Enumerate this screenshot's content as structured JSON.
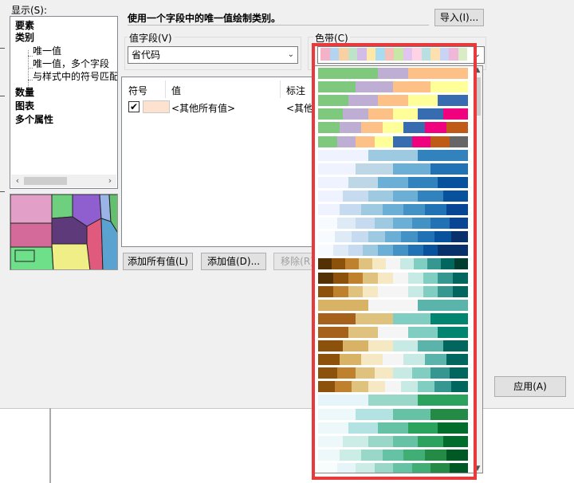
{
  "dialog": {
    "show_label": "显示(S):",
    "tree": [
      {
        "label": "要素",
        "bold": true,
        "indent": 0
      },
      {
        "label": "类别",
        "bold": true,
        "indent": 0
      },
      {
        "label": "唯一值",
        "bold": false,
        "indent": 1
      },
      {
        "label": "唯一值，多个字段",
        "bold": false,
        "indent": 1
      },
      {
        "label": "与样式中的符号匹配",
        "bold": false,
        "indent": 1
      },
      {
        "label": "数量",
        "bold": true,
        "indent": 0
      },
      {
        "label": "图表",
        "bold": true,
        "indent": 0
      },
      {
        "label": "多个属性",
        "bold": true,
        "indent": 0
      }
    ],
    "description": "使用一个字段中的唯一值绘制类别。",
    "import_button": "导入(I)...",
    "value_field": {
      "label": "值字段(V)",
      "value": "省代码"
    },
    "color_ramp": {
      "label": "色带(C)",
      "selected": [
        "#f3b2c8",
        "#b3d4f1",
        "#f9d0a2",
        "#bfe3c8",
        "#d3bce8",
        "#fde8a8",
        "#a9dcf0",
        "#f6c1b9",
        "#c8e6a5",
        "#e1c4f0",
        "#ffd3e6",
        "#b8e0e0",
        "#fce0b0",
        "#c9d3f5",
        "#f0b8d8",
        "#d9ecc6"
      ]
    },
    "list": {
      "columns": [
        "符号",
        "值",
        "标注"
      ],
      "rows": [
        {
          "checked": true,
          "swatch": "#fde2cf",
          "value": "<其他所有值>",
          "label": "<其他所"
        }
      ]
    },
    "add_all_button": "添加所有值(L)",
    "add_value_button": "添加值(D)...",
    "remove_button": "移除(R)",
    "apply_button": "应用(A)"
  },
  "ramps": [
    [
      "#7fc97f",
      "#7fc97f",
      "#beaed4",
      "#fdc086",
      "#fdc086"
    ],
    [
      "#7fc97f",
      "#beaed4",
      "#fdc086",
      "#ffff99"
    ],
    [
      "#7fc97f",
      "#beaed4",
      "#fdc086",
      "#ffff99",
      "#386cb0"
    ],
    [
      "#7fc97f",
      "#beaed4",
      "#fdc086",
      "#ffff99",
      "#386cb0",
      "#f0027f"
    ],
    [
      "#7fc97f",
      "#beaed4",
      "#fdc086",
      "#ffff99",
      "#386cb0",
      "#f0027f",
      "#bf5b17"
    ],
    [
      "#7fc97f",
      "#beaed4",
      "#fdc086",
      "#ffff99",
      "#386cb0",
      "#f0027f",
      "#bf5b17",
      "#666666"
    ],
    [
      "#eff3ff",
      "#eff3ff",
      "#9ecae1",
      "#9ecae1",
      "#3182bd",
      "#3182bd"
    ],
    [
      "#eff3ff",
      "#bdd7e7",
      "#6baed6",
      "#2171b5"
    ],
    [
      "#eff3ff",
      "#bdd7e7",
      "#6baed6",
      "#3182bd",
      "#08519c"
    ],
    [
      "#eff3ff",
      "#c6dbef",
      "#9ecae1",
      "#6baed6",
      "#3182bd",
      "#08519c"
    ],
    [
      "#eff3ff",
      "#c6dbef",
      "#9ecae1",
      "#6baed6",
      "#4292c6",
      "#2171b5",
      "#084594"
    ],
    [
      "#f7fbff",
      "#deebf7",
      "#c6dbef",
      "#9ecae1",
      "#6baed6",
      "#4292c6",
      "#2171b5",
      "#084594"
    ],
    [
      "#f7fbff",
      "#deebf7",
      "#c6dbef",
      "#9ecae1",
      "#6baed6",
      "#4292c6",
      "#2171b5",
      "#08519c",
      "#08306b"
    ],
    [
      "#f7fbff",
      "#deebf7",
      "#c6dbef",
      "#9ecae1",
      "#6baed6",
      "#4292c6",
      "#2171b5",
      "#08519c",
      "#08306b",
      "#08306b"
    ],
    [
      "#543005",
      "#8c510a",
      "#bf812d",
      "#dfc27d",
      "#f6e8c3",
      "#f5f5f5",
      "#c7eae5",
      "#80cdc1",
      "#35978f",
      "#01665e",
      "#003c30"
    ],
    [
      "#543005",
      "#8c510a",
      "#bf812d",
      "#dfc27d",
      "#f6e8c3",
      "#f5f5f5",
      "#c7eae5",
      "#80cdc1",
      "#35978f",
      "#01665e"
    ],
    [
      "#8c510a",
      "#bf812d",
      "#dfc27d",
      "#f6e8c3",
      "#f5f5f5",
      "#f5f5f5",
      "#c7eae5",
      "#80cdc1",
      "#35978f",
      "#01665e"
    ],
    [
      "#d8b365",
      "#d8b365",
      "#f5f5f5",
      "#f5f5f5",
      "#5ab4ac",
      "#5ab4ac"
    ],
    [
      "#a6611a",
      "#dfc27d",
      "#80cdc1",
      "#018571"
    ],
    [
      "#a6611a",
      "#dfc27d",
      "#f5f5f5",
      "#80cdc1",
      "#018571"
    ],
    [
      "#8c510a",
      "#d8b365",
      "#f6e8c3",
      "#c7eae5",
      "#5ab4ac",
      "#01665e"
    ],
    [
      "#8c510a",
      "#d8b365",
      "#f6e8c3",
      "#f5f5f5",
      "#c7eae5",
      "#5ab4ac",
      "#01665e"
    ],
    [
      "#8c510a",
      "#bf812d",
      "#dfc27d",
      "#f6e8c3",
      "#c7eae5",
      "#80cdc1",
      "#35978f",
      "#01665e"
    ],
    [
      "#8c510a",
      "#bf812d",
      "#dfc27d",
      "#f6e8c3",
      "#f5f5f5",
      "#c7eae5",
      "#80cdc1",
      "#35978f",
      "#01665e"
    ],
    [
      "#e5f5f9",
      "#e5f5f9",
      "#99d8c9",
      "#99d8c9",
      "#2ca25f",
      "#2ca25f"
    ],
    [
      "#edf8fb",
      "#b2e2e2",
      "#66c2a4",
      "#238b45"
    ],
    [
      "#edf8fb",
      "#b2e2e2",
      "#66c2a4",
      "#2ca25f",
      "#006d2c"
    ],
    [
      "#edf8fb",
      "#ccece6",
      "#99d8c9",
      "#66c2a4",
      "#2ca25f",
      "#006d2c"
    ],
    [
      "#edf8fb",
      "#ccece6",
      "#99d8c9",
      "#66c2a4",
      "#41ae76",
      "#238b45",
      "#005824"
    ],
    [
      "#f7fcfd",
      "#e5f5f9",
      "#ccece6",
      "#99d8c9",
      "#66c2a4",
      "#41ae76",
      "#238b45",
      "#005824"
    ]
  ]
}
